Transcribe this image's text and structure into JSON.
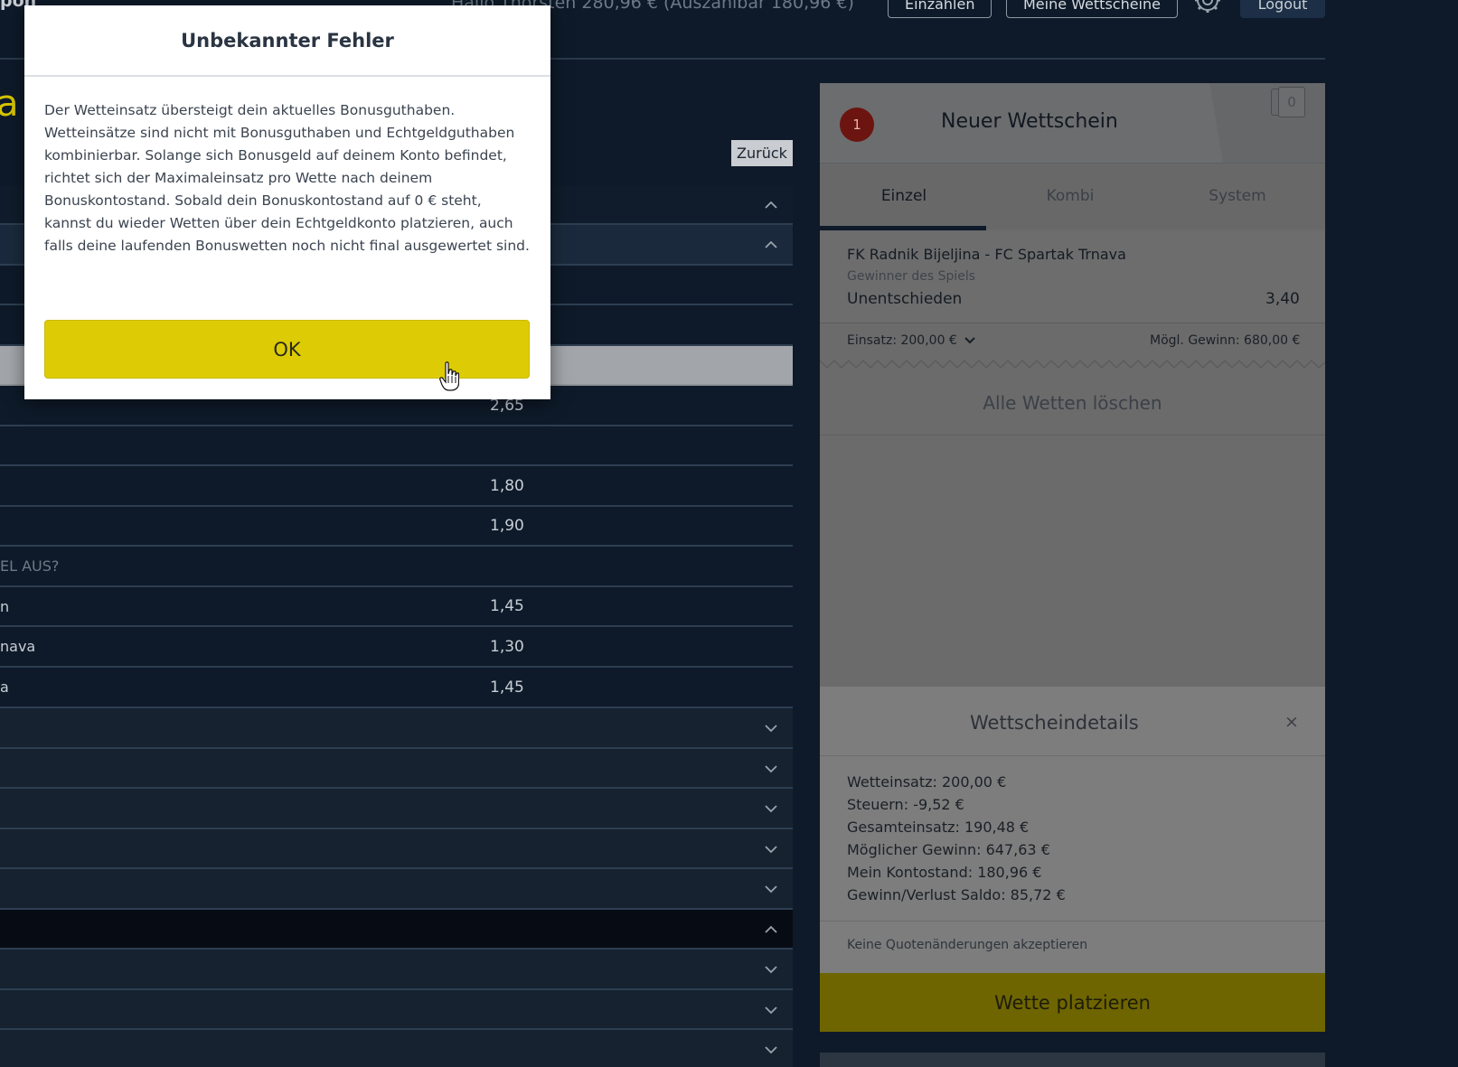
{
  "header": {
    "logo_text": "pon",
    "greeting": "Hallo  Thorsten   280,96 € (Auszahlbar 180,96 €)",
    "deposit_label": "Einzahlen",
    "my_bets_label": "Meine Wettscheine",
    "logout_label": "Logout"
  },
  "main": {
    "title_partial": "a",
    "back_label": "Zurück",
    "markets": [
      {
        "label": "",
        "odd": "2,65"
      },
      {
        "label": "",
        "odd": "1,80"
      },
      {
        "label": "",
        "odd": "1,90"
      },
      {
        "question": "EL AUS?"
      },
      {
        "label": "n",
        "odd": "1,45"
      },
      {
        "label": "nava",
        "odd": "1,30"
      },
      {
        "label": "a",
        "odd": "1,45"
      }
    ]
  },
  "betslip": {
    "count_badge": "1",
    "title": "Neuer Wettschein",
    "saved_count": "0",
    "tabs": [
      "Einzel",
      "Kombi",
      "System"
    ],
    "bet": {
      "match": "FK Radnik Bijeljina - FC Spartak Trnava",
      "market": "Gewinner des Spiels",
      "selection": "Unentschieden",
      "odd": "3,40"
    },
    "stake": "Einsatz: 200,00 €",
    "possible_win": "Mögl. Gewinn: 680,00 €",
    "clear_all": "Alle Wetten löschen",
    "details": {
      "title": "Wettscheindetails",
      "close": "×",
      "lines": [
        "Wetteinsatz: 200,00 €",
        "Steuern: -9,52 €",
        "Gesamteinsatz: 190,48 €",
        "Möglicher Gewinn: 647,63 €",
        "Mein Kontostand: 180,96 €",
        "Gewinn/Verlust Saldo: 85,72 €"
      ],
      "accept_changes": "Keine Quotenänderungen akzeptieren"
    },
    "place_bet": "Wette platzieren"
  },
  "modal": {
    "title": "Unbekannter Fehler",
    "message": "Der Wetteinsatz übersteigt dein aktuelles Bonusguthaben. Wetteinsätze sind nicht mit Bonusguthaben und Echtgeldguthaben kombinierbar. Solange sich Bonusgeld auf deinem Konto befindet, richtet sich der Maximaleinsatz pro Wette nach deinem Bonuskontostand. Sobald dein Bonuskontostand auf 0 € steht, kannst du wieder Wetten über dein Echtgeldkonto platzieren, auch falls deine laufenden Bonuswetten noch nicht final ausgewertet sind.",
    "ok_label": "OK"
  },
  "colors": {
    "background": "#0e1a29",
    "accent_yellow": "#ddcc05",
    "badge_red": "#6b1410"
  }
}
